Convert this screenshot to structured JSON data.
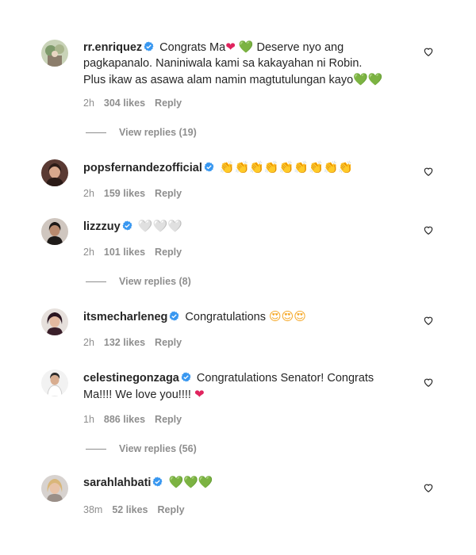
{
  "comments": [
    {
      "username": "rr.enriquez",
      "verified": true,
      "text_parts": [
        {
          "t": "Congrats Ma"
        },
        {
          "e": "❤",
          "c": "heart-red"
        },
        {
          "t": " "
        },
        {
          "e": "💚",
          "c": "heart-green"
        },
        {
          "t": " Deserve nyo ang pagkapanalo. Naniniwala kami sa kakayahan ni Robin. Plus ikaw as asawa alam namin magtutulungan kayo"
        },
        {
          "e": "💚💚",
          "c": "heart-green"
        }
      ],
      "time": "2h",
      "likes": "304 likes",
      "reply": "Reply",
      "view_replies": "View replies (19)"
    },
    {
      "username": "popsfernandezofficial",
      "verified": true,
      "text_parts": [
        {
          "e": "👏👏👏👏👏👏👏👏👏",
          "c": "clap"
        }
      ],
      "time": "2h",
      "likes": "159 likes",
      "reply": "Reply"
    },
    {
      "username": "lizzzuy",
      "verified": true,
      "text_parts": [
        {
          "e": "🤍🤍🤍",
          "c": "heart-white"
        }
      ],
      "time": "2h",
      "likes": "101 likes",
      "reply": "Reply",
      "view_replies": "View replies (8)"
    },
    {
      "username": "itsmecharleneg",
      "verified": true,
      "text_parts": [
        {
          "t": "Congratulations "
        },
        {
          "e": "😍😍😍",
          "c": "love-face"
        }
      ],
      "time": "2h",
      "likes": "132 likes",
      "reply": "Reply"
    },
    {
      "username": "celestinegonzaga",
      "verified": true,
      "text_parts": [
        {
          "t": "Congratulations Senator! Congrats Ma!!!! We love you!!!! "
        },
        {
          "e": "❤",
          "c": "heart-red"
        }
      ],
      "time": "1h",
      "likes": "886 likes",
      "reply": "Reply",
      "view_replies": "View replies (56)"
    },
    {
      "username": "sarahlahbati",
      "verified": true,
      "text_parts": [
        {
          "e": "💚💚💚",
          "c": "heart-green"
        }
      ],
      "time": "38m",
      "likes": "52 likes",
      "reply": "Reply"
    }
  ],
  "colors": {
    "text": "#262626",
    "muted": "#8e8e8e",
    "verified": "#3897f0",
    "background": "#ffffff"
  },
  "icons": {
    "verified": "verified-badge-icon",
    "like": "heart-outline-icon"
  }
}
